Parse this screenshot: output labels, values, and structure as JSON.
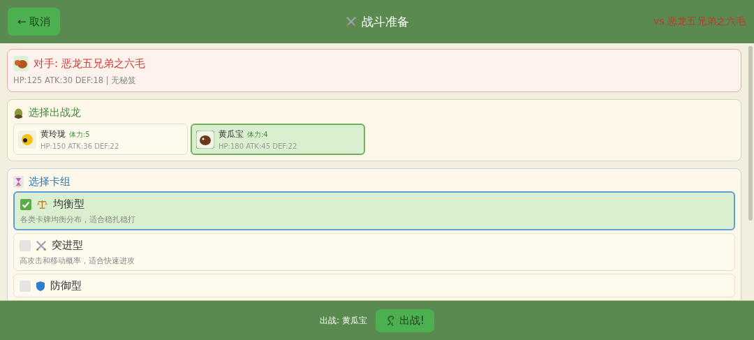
{
  "header": {
    "cancel_button": "← 取消",
    "title": "战斗准备",
    "opponent_tag": "vs 恶龙五兄弟之六毛"
  },
  "opponent": {
    "name": "对手: 恶龙五兄弟之六毛",
    "stats": "HP:125  ATK:30  DEF:18  |  无秘笈"
  },
  "dragon_section": {
    "title": "选择出战龙",
    "dragons": [
      {
        "name": "黄玲珑",
        "stamina": "体力:5",
        "stats": "HP:150 ATK:36 DEF:22",
        "selected": false
      },
      {
        "name": "黄瓜宝",
        "stamina": "体力:4",
        "stats": "HP:180 ATK:45 DEF:22",
        "selected": true
      }
    ]
  },
  "deck_section": {
    "title": "选择卡组",
    "decks": [
      {
        "kind": "balance",
        "name": "均衡型",
        "description": "各类卡牌均衡分布，适合稳扎稳打",
        "selected": true,
        "checked": true
      },
      {
        "kind": "attack",
        "name": "突进型",
        "description": "高攻击和移动概率，适合快速进攻",
        "selected": false,
        "checked": false
      },
      {
        "kind": "defense",
        "name": "防御型",
        "selected": false,
        "checked": false
      }
    ]
  },
  "footer": {
    "summary": "出战: 黄瓜宝",
    "fight_button": "出战!"
  }
}
